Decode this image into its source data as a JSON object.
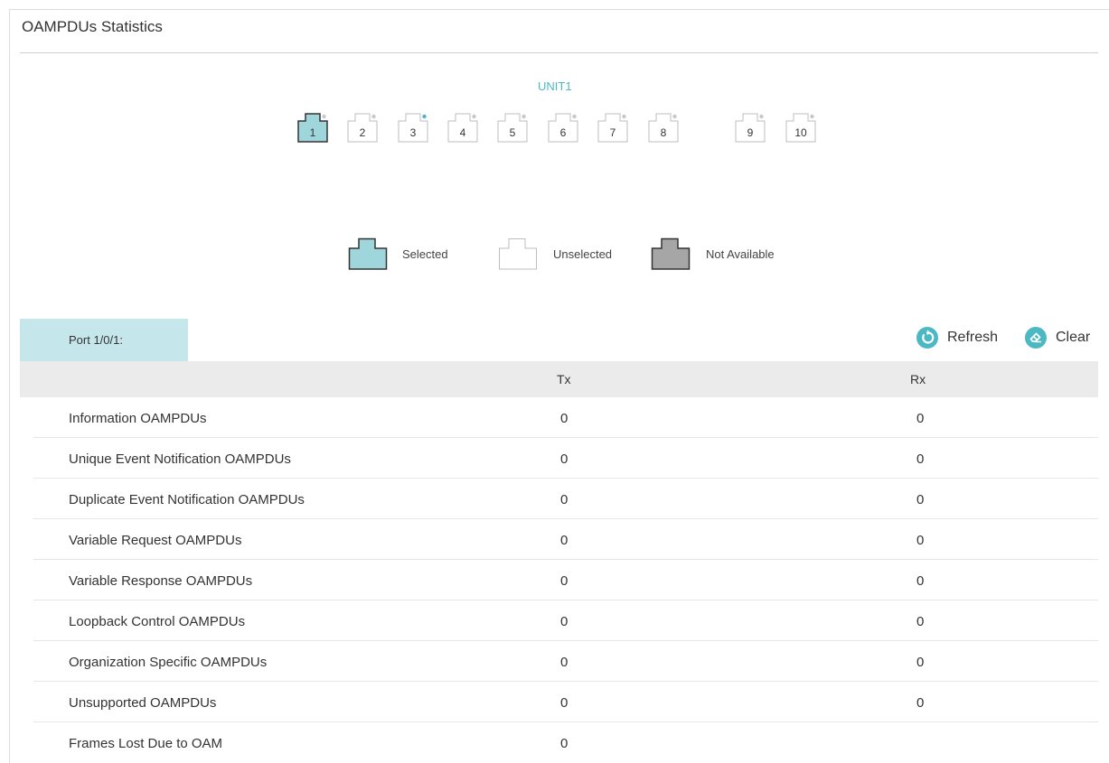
{
  "panel": {
    "title": "OAMPDUs Statistics"
  },
  "unit": {
    "label": "UNIT1"
  },
  "ports": [
    {
      "number": "1",
      "state": "selected",
      "indicator": "gray"
    },
    {
      "number": "2",
      "state": "unselected",
      "indicator": "gray"
    },
    {
      "number": "3",
      "state": "unselected",
      "indicator": "teal"
    },
    {
      "number": "4",
      "state": "unselected",
      "indicator": "gray"
    },
    {
      "number": "5",
      "state": "unselected",
      "indicator": "gray"
    },
    {
      "number": "6",
      "state": "unselected",
      "indicator": "gray"
    },
    {
      "number": "7",
      "state": "unselected",
      "indicator": "gray"
    },
    {
      "number": "8",
      "state": "unselected",
      "indicator": "gray"
    },
    {
      "number": "9",
      "state": "unselected",
      "indicator": "gray"
    },
    {
      "number": "10",
      "state": "unselected",
      "indicator": "gray"
    }
  ],
  "legend": {
    "selected": "Selected",
    "unselected": "Unselected",
    "not_available": "Not Available"
  },
  "port_tab": {
    "label": "Port 1/0/1:"
  },
  "actions": {
    "refresh": "Refresh",
    "clear": "Clear"
  },
  "table": {
    "headers": {
      "tx": "Tx",
      "rx": "Rx"
    },
    "rows": [
      {
        "label": "Information OAMPDUs",
        "tx": "0",
        "rx": "0"
      },
      {
        "label": "Unique Event Notification OAMPDUs",
        "tx": "0",
        "rx": "0"
      },
      {
        "label": "Duplicate Event Notification OAMPDUs",
        "tx": "0",
        "rx": "0"
      },
      {
        "label": "Variable Request OAMPDUs",
        "tx": "0",
        "rx": "0"
      },
      {
        "label": "Variable Response OAMPDUs",
        "tx": "0",
        "rx": "0"
      },
      {
        "label": "Loopback Control OAMPDUs",
        "tx": "0",
        "rx": "0"
      },
      {
        "label": "Organization Specific OAMPDUs",
        "tx": "0",
        "rx": "0"
      },
      {
        "label": "Unsupported OAMPDUs",
        "tx": "0",
        "rx": "0"
      },
      {
        "label": "Frames Lost Due to OAM",
        "tx": "0",
        "rx": ""
      }
    ]
  },
  "colors": {
    "accent": "#4cb8c4",
    "selected_fill": "#9fd6dc",
    "not_available_fill": "#a6a6a6",
    "tab_bg": "#c5e6ea",
    "header_bg": "#ebebeb"
  }
}
